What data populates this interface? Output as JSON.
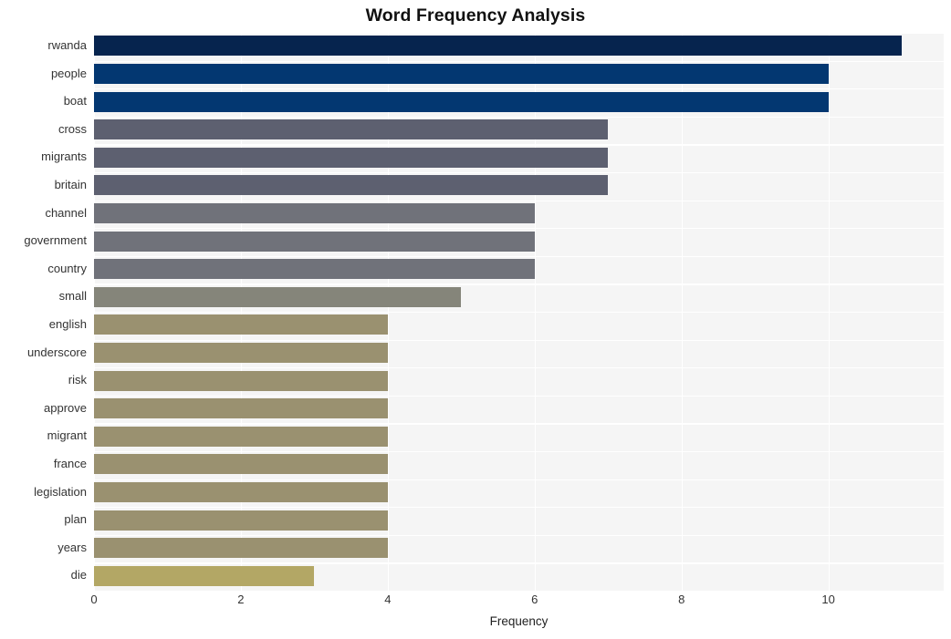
{
  "chart_data": {
    "type": "bar",
    "orientation": "horizontal",
    "title": "Word Frequency Analysis",
    "xlabel": "Frequency",
    "ylabel": "",
    "xlim": [
      0,
      11.57
    ],
    "xticks": [
      0,
      2,
      4,
      6,
      8,
      10
    ],
    "xtick_labels": [
      "0",
      "2",
      "4",
      "6",
      "8",
      "10"
    ],
    "grid": true,
    "legend": false,
    "plot_background": "#f5f5f5",
    "grid_color": "#ffffff",
    "categories": [
      "rwanda",
      "people",
      "boat",
      "cross",
      "migrants",
      "britain",
      "channel",
      "government",
      "country",
      "small",
      "english",
      "underscore",
      "risk",
      "approve",
      "migrant",
      "france",
      "legislation",
      "plan",
      "years",
      "die"
    ],
    "values": [
      11,
      10,
      10,
      7,
      7,
      7,
      6,
      6,
      6,
      5,
      4,
      4,
      4,
      4,
      4,
      4,
      4,
      4,
      4,
      3
    ],
    "bar_colors": [
      "#06244e",
      "#033771",
      "#033771",
      "#5d6070",
      "#5d6070",
      "#5d6070",
      "#70727a",
      "#70727a",
      "#70727a",
      "#85857a",
      "#9a9170",
      "#9a9170",
      "#9a9170",
      "#9a9170",
      "#9a9170",
      "#9a9170",
      "#9a9170",
      "#9a9170",
      "#9a9170",
      "#b3a765"
    ]
  }
}
